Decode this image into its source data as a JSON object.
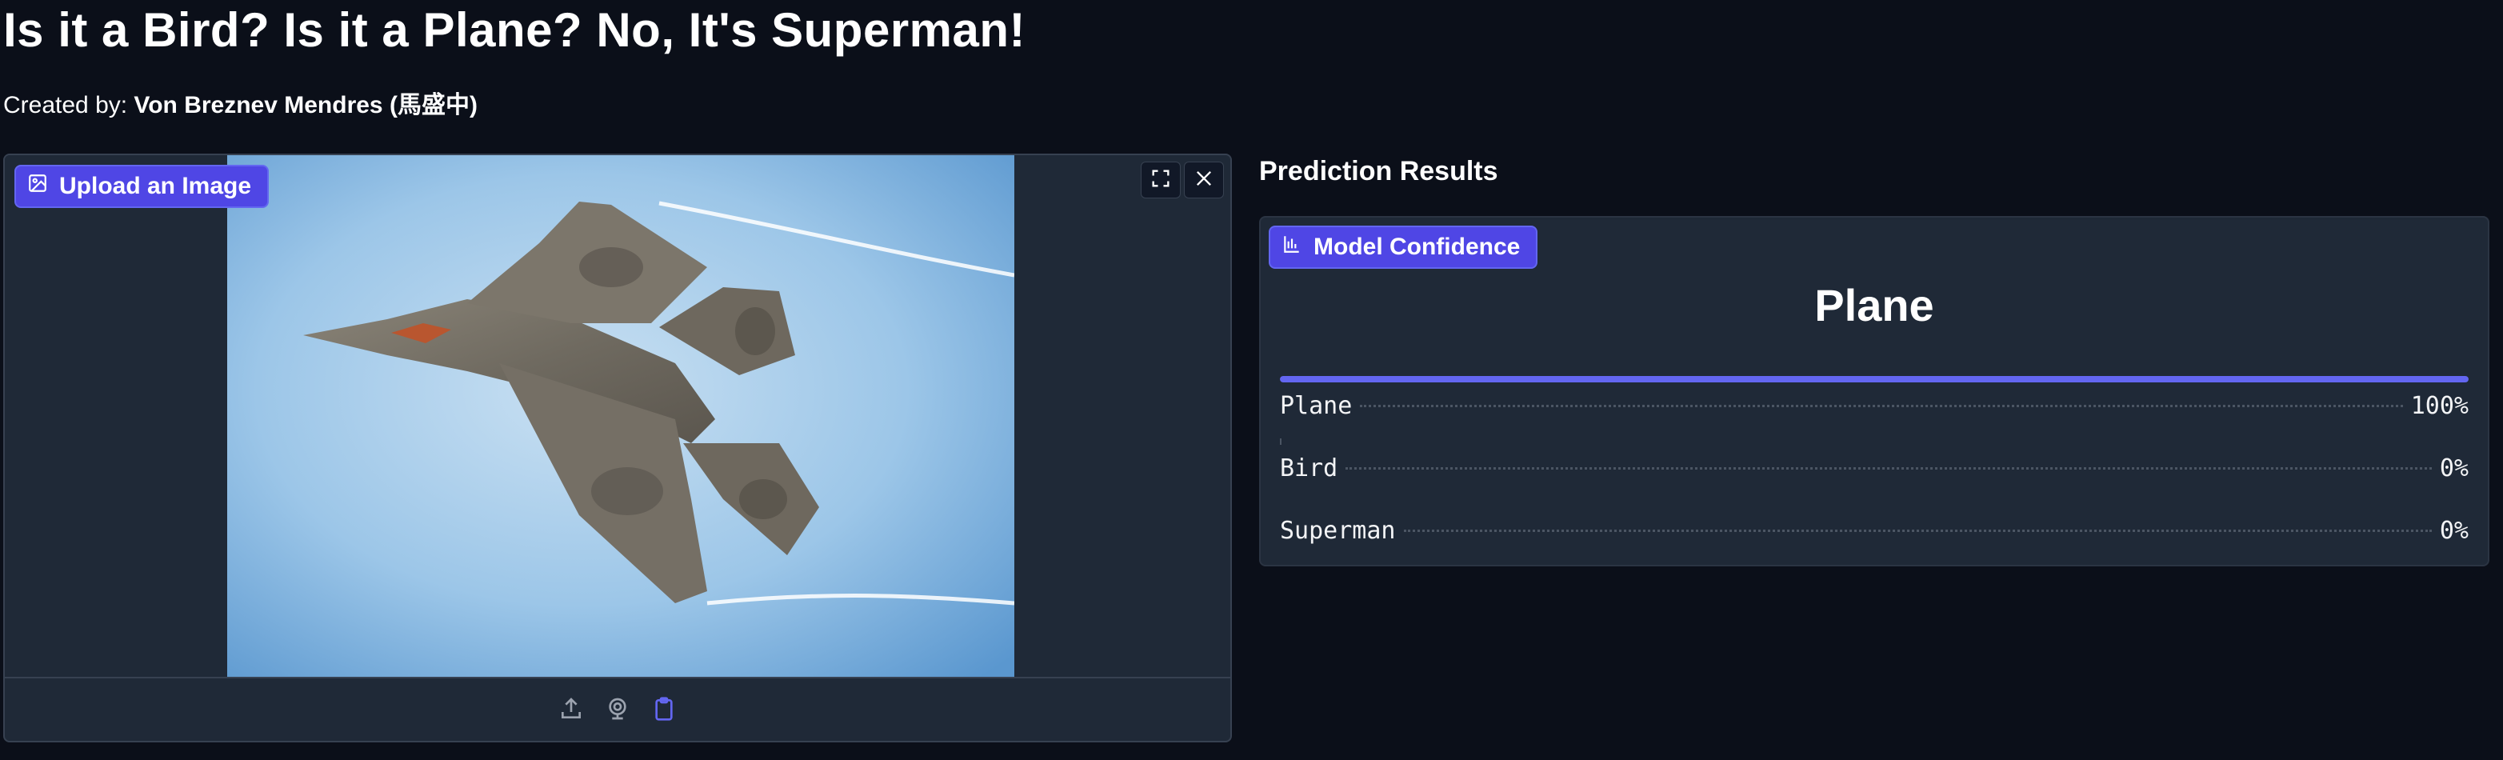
{
  "page": {
    "title": "Is it a Bird? Is it a Plane? No, It's Superman!",
    "created_by_label": "Created by: ",
    "author": "Von Breznev Mendres (馬盛中)"
  },
  "image_input": {
    "badge_label": "Upload an Image",
    "badge_icon": "image-icon",
    "tools": [
      "fullscreen-icon",
      "close-icon"
    ],
    "sources": [
      "upload-icon",
      "webcam-icon",
      "clipboard-icon"
    ]
  },
  "results": {
    "heading": "Prediction Results",
    "badge_label": "Model Confidence",
    "badge_icon": "bar-chart-icon",
    "top_label": "Plane",
    "top_confidence": 1.0,
    "rows": [
      {
        "label": "Plane",
        "value": "100%",
        "fraction": 1.0
      },
      {
        "label": "Bird",
        "value": "0%",
        "fraction": 0
      },
      {
        "label": "Superman",
        "value": "0%",
        "fraction": 0
      }
    ]
  },
  "colors": {
    "background": "#0b0f19",
    "panel": "#1f2937",
    "accent": "#4f46e5",
    "accent_light": "#6366f1"
  }
}
